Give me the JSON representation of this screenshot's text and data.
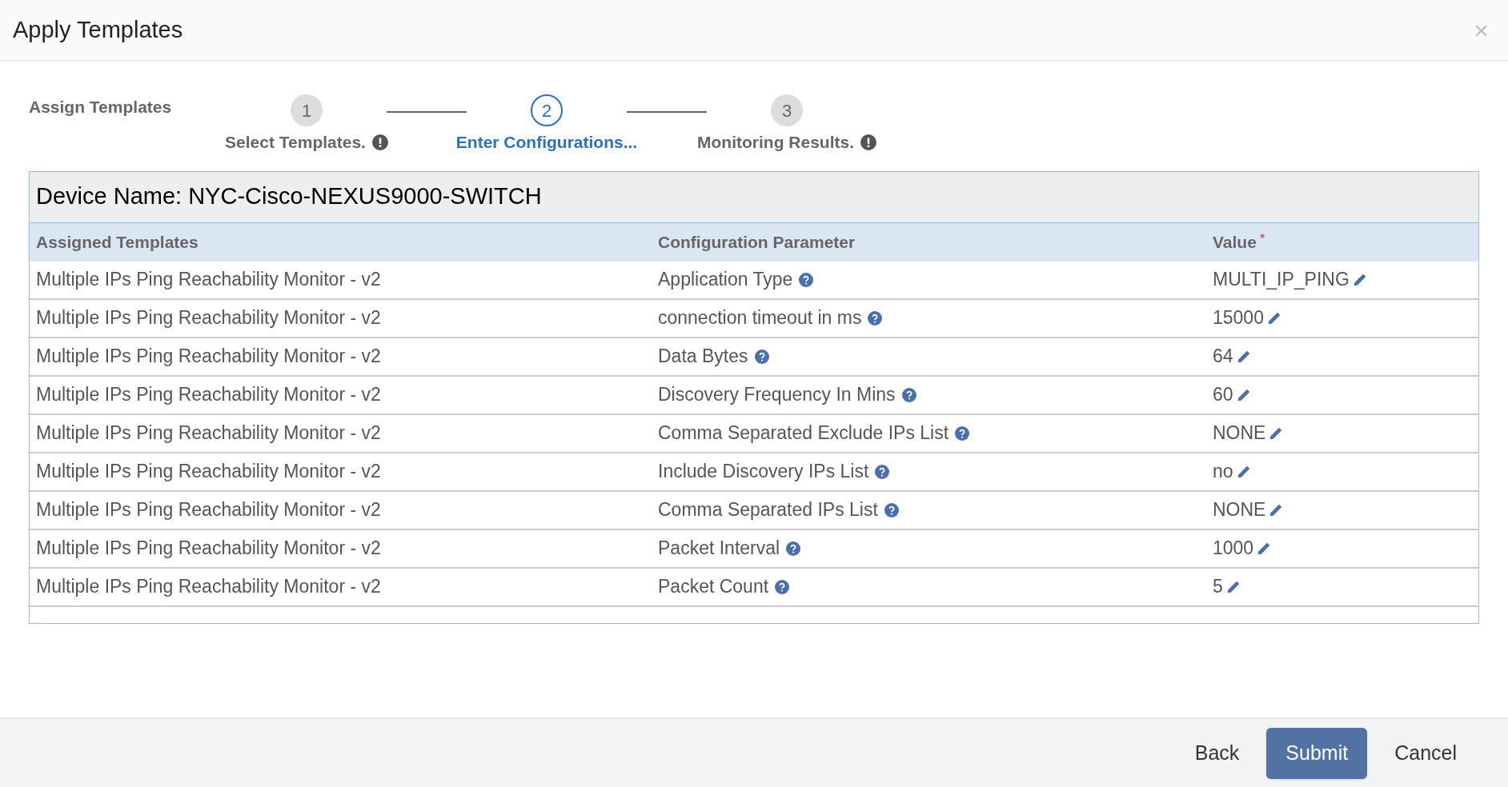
{
  "dialog": {
    "title": "Apply Templates",
    "close_label": "×"
  },
  "wizard": {
    "label": "Assign Templates",
    "steps": [
      {
        "number": "1",
        "label": "Select Templates.",
        "selected": false,
        "warning": true
      },
      {
        "number": "2",
        "label": "Enter Configurations...",
        "selected": true,
        "warning": false
      },
      {
        "number": "3",
        "label": "Monitoring Results.",
        "selected": false,
        "warning": true
      }
    ]
  },
  "device": {
    "title": "Device Name: NYC-Cisco-NEXUS9000-SWITCH"
  },
  "table": {
    "columns": [
      {
        "label": "Assigned Templates"
      },
      {
        "label": "Configuration Parameter"
      },
      {
        "label": "Value",
        "required_mark": "*"
      }
    ],
    "rows": [
      {
        "template": "Multiple IPs Ping Reachability Monitor - v2",
        "parameter": "Application Type",
        "value": "MULTI_IP_PING"
      },
      {
        "template": "Multiple IPs Ping Reachability Monitor - v2",
        "parameter": "connection timeout in ms",
        "value": "15000"
      },
      {
        "template": "Multiple IPs Ping Reachability Monitor - v2",
        "parameter": "Data Bytes",
        "value": "64"
      },
      {
        "template": "Multiple IPs Ping Reachability Monitor - v2",
        "parameter": "Discovery Frequency In Mins",
        "value": "60"
      },
      {
        "template": "Multiple IPs Ping Reachability Monitor - v2",
        "parameter": "Comma Separated Exclude IPs List",
        "value": "NONE"
      },
      {
        "template": "Multiple IPs Ping Reachability Monitor - v2",
        "parameter": "Include Discovery IPs List",
        "value": "no"
      },
      {
        "template": "Multiple IPs Ping Reachability Monitor - v2",
        "parameter": "Comma Separated IPs List",
        "value": "NONE"
      },
      {
        "template": "Multiple IPs Ping Reachability Monitor - v2",
        "parameter": "Packet Interval",
        "value": "1000"
      },
      {
        "template": "Multiple IPs Ping Reachability Monitor - v2",
        "parameter": "Packet Count",
        "value": "5"
      }
    ]
  },
  "footer": {
    "buttons": [
      {
        "label": "Back",
        "kind": "link"
      },
      {
        "label": "Submit",
        "kind": "primary"
      },
      {
        "label": "Cancel",
        "kind": "link"
      }
    ]
  }
}
